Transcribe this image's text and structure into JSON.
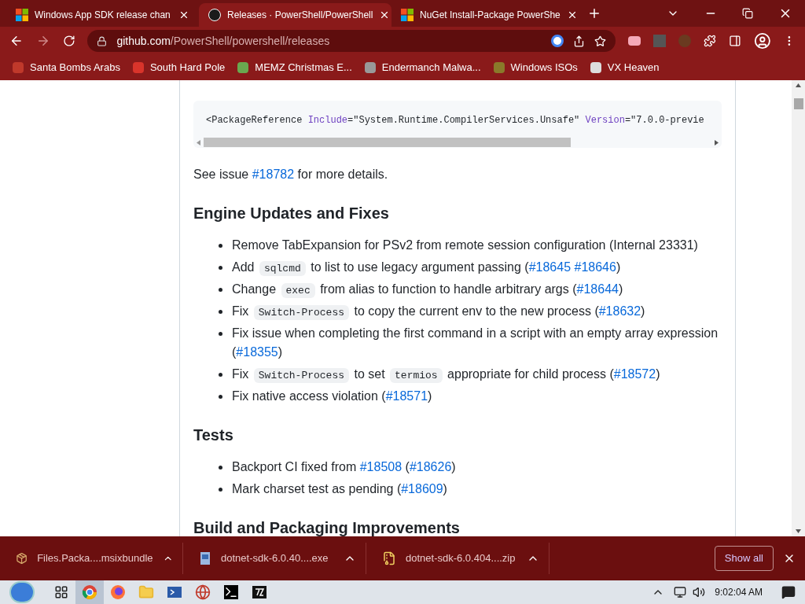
{
  "tabs": [
    {
      "title": "Windows App SDK release chan",
      "selected": false
    },
    {
      "title": "Releases · PowerShell/PowerShell",
      "selected": true
    },
    {
      "title": "NuGet Install-Package PowerShe",
      "selected": false
    }
  ],
  "address": {
    "host": "github.com",
    "path": "/PowerShell/powershell/releases"
  },
  "bookmarks": [
    {
      "label": "Santa Bombs Arabs",
      "color": "#c0392b"
    },
    {
      "label": "South Hard Pole",
      "color": "#d9342b"
    },
    {
      "label": "MEMZ Christmas E...",
      "color": "#6aa84f"
    },
    {
      "label": "Endermanch Malwa...",
      "color": "#999999"
    },
    {
      "label": "Windows ISOs",
      "color": "#8a7a2a"
    },
    {
      "label": "VX Heaven",
      "color": "#dddddd"
    }
  ],
  "code_block": [
    {
      "kind": "plain",
      "text": "<PackageReference "
    },
    {
      "kind": "attr",
      "text": "Include"
    },
    {
      "kind": "plain",
      "text": "=\"System.Runtime.CompilerServices.Unsafe\" "
    },
    {
      "kind": "attr",
      "text": "Version"
    },
    {
      "kind": "plain",
      "text": "=\"7.0.0-previe"
    }
  ],
  "see_issue": [
    {
      "kind": "text",
      "text": "See issue "
    },
    {
      "kind": "link",
      "text": "#18782"
    },
    {
      "kind": "text",
      "text": " for more details."
    }
  ],
  "sections": [
    {
      "heading": "Engine Updates and Fixes",
      "items": [
        [
          {
            "kind": "text",
            "text": "Remove TabExpansion for PSv2 from remote session configuration (Internal 23331)"
          }
        ],
        [
          {
            "kind": "text",
            "text": "Add "
          },
          {
            "kind": "code",
            "text": "sqlcmd"
          },
          {
            "kind": "text",
            "text": " to list to use legacy argument passing ("
          },
          {
            "kind": "link",
            "text": "#18645"
          },
          {
            "kind": "link",
            "text": "#18646"
          },
          {
            "kind": "text",
            "text": ")"
          }
        ],
        [
          {
            "kind": "text",
            "text": "Change "
          },
          {
            "kind": "code",
            "text": "exec"
          },
          {
            "kind": "text",
            "text": " from alias to function to handle arbitrary args ("
          },
          {
            "kind": "link",
            "text": "#18644"
          },
          {
            "kind": "text",
            "text": ")"
          }
        ],
        [
          {
            "kind": "text",
            "text": "Fix "
          },
          {
            "kind": "code",
            "text": "Switch-Process"
          },
          {
            "kind": "text",
            "text": " to copy the current env to the new process ("
          },
          {
            "kind": "link",
            "text": "#18632"
          },
          {
            "kind": "text",
            "text": ")"
          }
        ],
        [
          {
            "kind": "text",
            "text": "Fix issue when completing the first command in a script with an empty array expression ("
          },
          {
            "kind": "link",
            "text": "#18355"
          },
          {
            "kind": "text",
            "text": ")"
          }
        ],
        [
          {
            "kind": "text",
            "text": "Fix "
          },
          {
            "kind": "code",
            "text": "Switch-Process"
          },
          {
            "kind": "text",
            "text": " to set "
          },
          {
            "kind": "code",
            "text": "termios"
          },
          {
            "kind": "text",
            "text": " appropriate for child process ("
          },
          {
            "kind": "link",
            "text": "#18572"
          },
          {
            "kind": "text",
            "text": ")"
          }
        ],
        [
          {
            "kind": "text",
            "text": "Fix native access violation ("
          },
          {
            "kind": "link",
            "text": "#18571"
          },
          {
            "kind": "text",
            "text": ")"
          }
        ]
      ]
    },
    {
      "heading": "Tests",
      "items": [
        [
          {
            "kind": "text",
            "text": "Backport CI fixed from "
          },
          {
            "kind": "link",
            "text": "#18508"
          },
          {
            "kind": "text",
            "text": " ("
          },
          {
            "kind": "link",
            "text": "#18626"
          },
          {
            "kind": "text",
            "text": ")"
          }
        ],
        [
          {
            "kind": "text",
            "text": "Mark charset test as pending ("
          },
          {
            "kind": "link",
            "text": "#18609"
          },
          {
            "kind": "text",
            "text": ")"
          }
        ]
      ]
    },
    {
      "heading": "Build and Packaging Improvements"
    }
  ],
  "downloads": [
    {
      "name": "Files.Packa....msixbundle",
      "kind": "package"
    },
    {
      "name": "dotnet-sdk-6.0.40....exe",
      "kind": "installer"
    },
    {
      "name": "dotnet-sdk-6.0.404....zip",
      "kind": "zip"
    }
  ],
  "show_all": "Show all",
  "taskbar": {
    "apps": [
      {
        "kind": "taskview",
        "active": false
      },
      {
        "kind": "chrome",
        "active": true
      },
      {
        "kind": "firefox",
        "active": false
      },
      {
        "kind": "folder",
        "active": false
      },
      {
        "kind": "powershell",
        "active": false
      },
      {
        "kind": "globe",
        "active": false
      },
      {
        "kind": "cmd",
        "active": false
      },
      {
        "kind": "sevenzip",
        "active": false
      }
    ],
    "time": "9:02:04 AM"
  }
}
